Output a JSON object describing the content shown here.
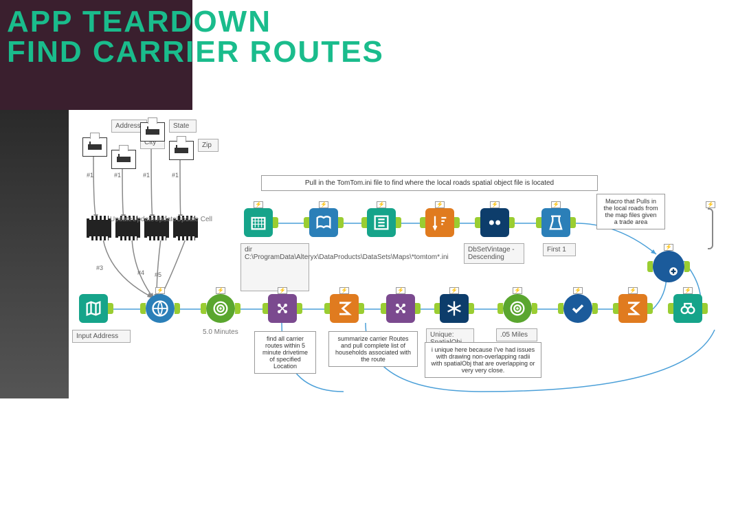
{
  "title_line1": "APP TEARDOWN",
  "title_line2": "FIND CARRIER ROUTES",
  "top_interface": {
    "address_label": "Address",
    "city_label": "City",
    "state_label": "State",
    "zip_label": "Zip"
  },
  "wires": {
    "w1": "#1",
    "w2": "#1",
    "w3": "#1",
    "w4": "#1",
    "w5": "#3",
    "w6": "#4",
    "w7": "#5"
  },
  "actions": {
    "update1": "Update",
    "update2": "Update",
    "update3": "Update",
    "update4": "Update Cell"
  },
  "top_annotation": "Pull in the TomTom.ini file to find where the local roads spatial object file is located",
  "right_annotation": "Macro that Pulls in the local roads from the map files given a trade area",
  "dir_label": "dir\nC:\\ProgramData\\Alteryx\\DataProducts\\DataSets\\Maps\\*tomtom*.ini",
  "sort_label": "DbSetVintage - Descending",
  "sample_label": "First 1",
  "bottom_labels": {
    "input_address": "Input Address",
    "trade_area": "5.0 Minutes",
    "find_all": "find all carrier routes within 5 minute drivetime of specified Location",
    "summarize": "summarize carrier Routes and pull complete list of households associated with the route",
    "unique": "Unique: SpatialObj",
    "unique_note": "i unique here because I've had issues with drawing non-overlapping radii with spatialObj that are overlapping or very very close.",
    "trade_area2": ".05 Miles"
  }
}
